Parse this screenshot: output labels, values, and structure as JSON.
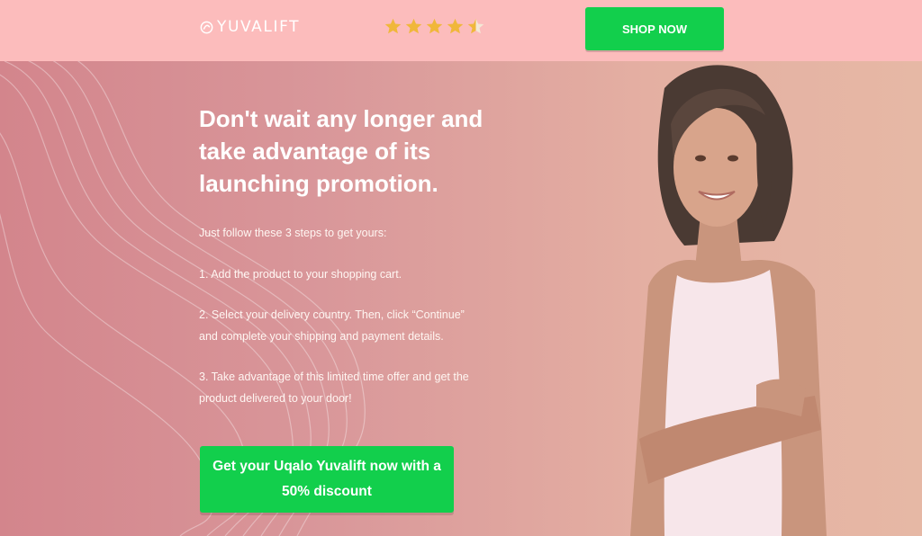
{
  "header": {
    "logo_text": "YUVALIFT",
    "rating": 4.5,
    "shop_button_label": "SHOP NOW"
  },
  "hero": {
    "headline": "Don't wait any longer and take advantage of its launching promotion.",
    "intro": "Just follow these 3 steps to get yours:",
    "steps": [
      "1. Add the product to your shopping cart.",
      "2. Select your delivery country. Then, click “Continue” and complete your shipping and payment details.",
      "3. Take advantage of this limited time offer and get the product delivered to your door!"
    ],
    "cta_label": "Get your Uqalo Yuvalift now with a 50% discount"
  },
  "colors": {
    "header_bg": "#fcbcbc",
    "accent_green": "#12cf4c",
    "star_gold": "#f0b73a"
  },
  "icons": {
    "logo": "circle-swirl-icon",
    "rating": "star-icon"
  }
}
